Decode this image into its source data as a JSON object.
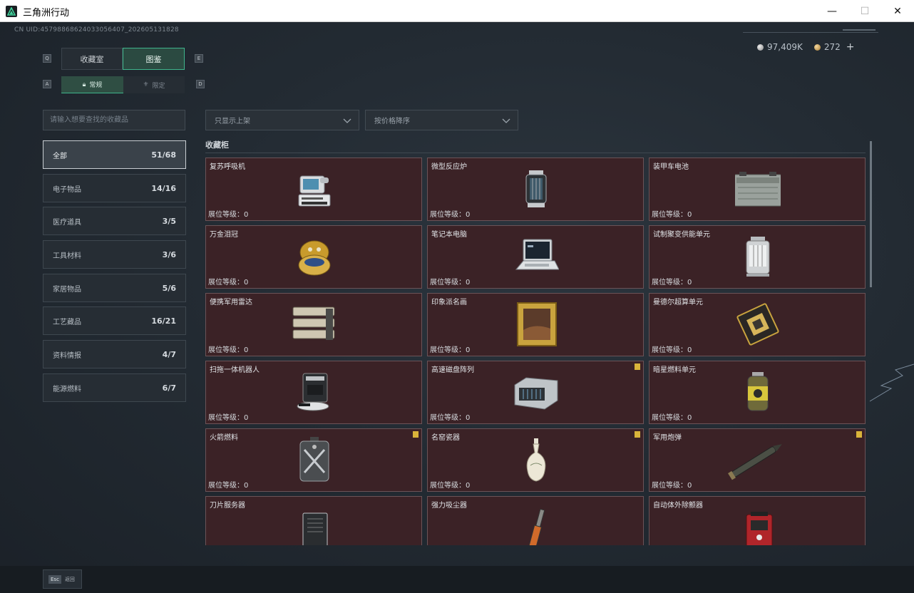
{
  "window": {
    "title": "三角洲行动",
    "minimize_glyph": "—",
    "maximize_glyph": "☐",
    "close_glyph": "✕"
  },
  "header": {
    "uid": "CN UID:457988686240330564​07_202605131828",
    "currency_silver": "97,409K",
    "currency_gold": "272",
    "plus": "+"
  },
  "keys": {
    "tab_prev": "Q",
    "tab_next": "E",
    "sub_prev": "A",
    "sub_next": "D"
  },
  "tabs": [
    {
      "label": "收藏室"
    },
    {
      "label": "图鉴"
    }
  ],
  "subtabs": [
    {
      "label": "常规",
      "icon": "lock-icon"
    },
    {
      "label": "限定",
      "icon": "badge-icon"
    }
  ],
  "search": {
    "placeholder": "请输入想要查找的收藏品"
  },
  "filters": {
    "shelf": "只显示上架",
    "sort": "按价格降序"
  },
  "categories": [
    {
      "label": "全部",
      "count": "51/68"
    },
    {
      "label": "电子物品",
      "count": "14/16"
    },
    {
      "label": "医疗道具",
      "count": "3/5"
    },
    {
      "label": "工具材料",
      "count": "3/6"
    },
    {
      "label": "家居物品",
      "count": "5/6"
    },
    {
      "label": "工艺藏品",
      "count": "16/21"
    },
    {
      "label": "资料情报",
      "count": "4/7"
    },
    {
      "label": "能源燃料",
      "count": "6/7"
    }
  ],
  "section": {
    "title": "收藏柜"
  },
  "level_label": "展位等级：",
  "items": [
    {
      "name": "复苏呼吸机",
      "level": "0",
      "icon": "ventilator-icon",
      "badge": false
    },
    {
      "name": "微型反应炉",
      "level": "0",
      "icon": "reactor-icon",
      "badge": false
    },
    {
      "name": "装甲车电池",
      "level": "0",
      "icon": "battery-icon",
      "badge": false
    },
    {
      "name": "万金泪冠",
      "level": "0",
      "icon": "jewel-egg-icon",
      "badge": false
    },
    {
      "name": "笔记本电脑",
      "level": "0",
      "icon": "laptop-icon",
      "badge": false
    },
    {
      "name": "试制聚变供能单元",
      "level": "0",
      "icon": "fusion-cell-icon",
      "badge": false
    },
    {
      "name": "便携军用雷达",
      "level": "0",
      "icon": "radar-icon",
      "badge": false
    },
    {
      "name": "印象派名画",
      "level": "0",
      "icon": "painting-icon",
      "badge": false
    },
    {
      "name": "曼德尔超算单元",
      "level": "0",
      "icon": "chip-icon",
      "badge": false
    },
    {
      "name": "扫拖一体机器人",
      "level": "0",
      "icon": "robot-vacuum-icon",
      "badge": false
    },
    {
      "name": "高速磁盘阵列",
      "level": "0",
      "icon": "disk-array-icon",
      "badge": true
    },
    {
      "name": "暗星燃料单元",
      "level": "0",
      "icon": "fuel-canister-icon",
      "badge": false
    },
    {
      "name": "火箭燃料",
      "level": "0",
      "icon": "fuel-tank-icon",
      "badge": true
    },
    {
      "name": "名窑瓷器",
      "level": "0",
      "icon": "vase-icon",
      "badge": true
    },
    {
      "name": "军用炮弹",
      "level": "0",
      "icon": "shell-icon",
      "badge": true
    },
    {
      "name": "刀片服务器",
      "level": "",
      "icon": "server-icon",
      "badge": false
    },
    {
      "name": "强力吸尘器",
      "level": "",
      "icon": "vacuum-icon",
      "badge": false
    },
    {
      "name": "自动体外除颤器",
      "level": "",
      "icon": "defibrillator-icon",
      "badge": false
    }
  ],
  "footer": {
    "esc_key": "Esc",
    "back_label": "返回"
  }
}
